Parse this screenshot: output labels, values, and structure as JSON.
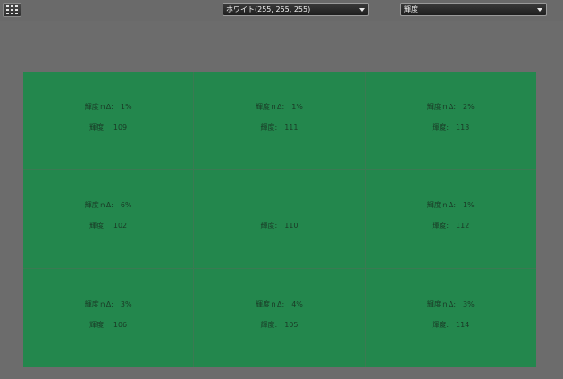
{
  "toolbar": {
    "grid_icon": "grid-icon",
    "color_select": {
      "value": "ホワイト(255, 255, 255)"
    },
    "mode_select": {
      "value": "輝度"
    }
  },
  "cells": [
    {
      "delta_label": "輝度ｎΔ:",
      "delta_value": "1%",
      "value_label": "輝度:",
      "value": "109"
    },
    {
      "delta_label": "輝度ｎΔ:",
      "delta_value": "1%",
      "value_label": "輝度:",
      "value": "111"
    },
    {
      "delta_label": "輝度ｎΔ:",
      "delta_value": "2%",
      "value_label": "輝度:",
      "value": "113"
    },
    {
      "delta_label": "輝度ｎΔ:",
      "delta_value": "6%",
      "value_label": "輝度:",
      "value": "102"
    },
    {
      "delta_label": "",
      "delta_value": "",
      "value_label": "輝度:",
      "value": "110"
    },
    {
      "delta_label": "輝度ｎΔ:",
      "delta_value": "1%",
      "value_label": "輝度:",
      "value": "112"
    },
    {
      "delta_label": "輝度ｎΔ:",
      "delta_value": "3%",
      "value_label": "輝度:",
      "value": "106"
    },
    {
      "delta_label": "輝度ｎΔ:",
      "delta_value": "4%",
      "value_label": "輝度:",
      "value": "105"
    },
    {
      "delta_label": "輝度ｎΔ:",
      "delta_value": "3%",
      "value_label": "輝度:",
      "value": "114"
    }
  ],
  "colors": {
    "background": "#6c6c6c",
    "panel": "#23874d",
    "cell_text": "#1a3a26"
  }
}
